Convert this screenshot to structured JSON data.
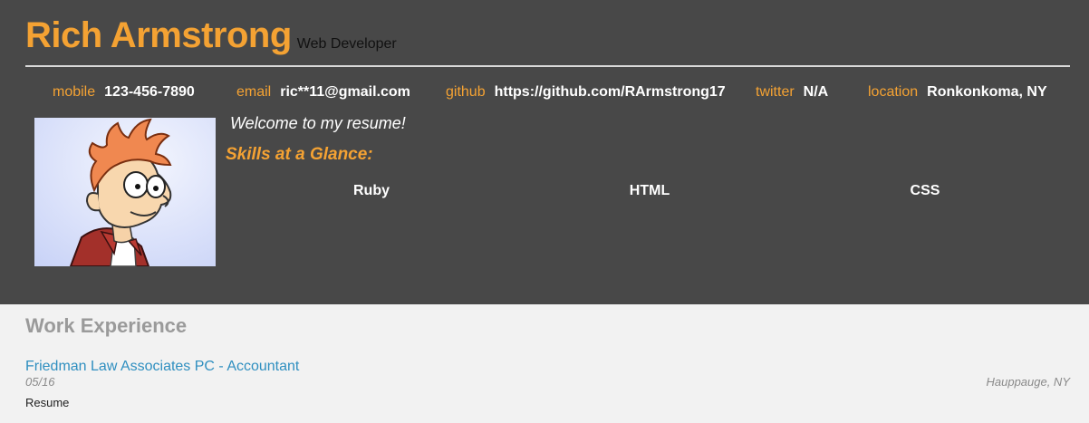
{
  "header": {
    "name": "Rich Armstrong",
    "title": "Web Developer"
  },
  "contacts": [
    {
      "label": "mobile",
      "value": "123-456-7890"
    },
    {
      "label": "email",
      "value": "ric**11@gmail.com"
    },
    {
      "label": "github",
      "value": "https://github.com/RArmstrong17"
    },
    {
      "label": "twitter",
      "value": "N/A"
    },
    {
      "label": "location",
      "value": "Ronkonkoma, NY"
    }
  ],
  "intro": {
    "welcome": "Welcome to my resume!",
    "skills_heading": "Skills at a Glance:",
    "skills": [
      "Ruby",
      "HTML",
      "CSS"
    ]
  },
  "work": {
    "heading": "Work Experience",
    "jobs": [
      {
        "title": "Friedman Law Associates PC - Accountant",
        "date": "05/16",
        "location": "Hauppauge, NY",
        "description": "Resume"
      }
    ]
  },
  "colors": {
    "accent": "#f4a233",
    "header_bg": "#484848",
    "page_bg": "#f2f2f2",
    "link": "#2f8fc0"
  },
  "icons": {
    "avatar": "cartoon-character-portrait"
  }
}
